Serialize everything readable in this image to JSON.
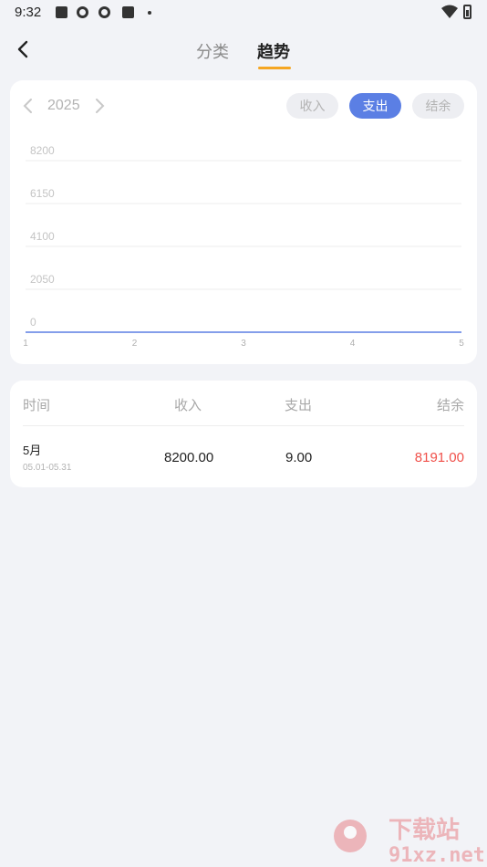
{
  "status_bar": {
    "time": "9:32"
  },
  "tabs": [
    {
      "label": "分类",
      "active": false
    },
    {
      "label": "趋势",
      "active": true
    }
  ],
  "year_selector": {
    "year": "2025"
  },
  "chart_filters": [
    {
      "label": "收入",
      "active": false
    },
    {
      "label": "支出",
      "active": true
    },
    {
      "label": "结余",
      "active": false
    }
  ],
  "colors": {
    "accent": "#5b7fe4",
    "tab_indicator": "#f5a623",
    "negative_text": "#f0504a"
  },
  "chart_data": {
    "type": "line",
    "title": "",
    "xlabel": "",
    "ylabel": "",
    "x": [
      1,
      2,
      3,
      4,
      5
    ],
    "series": [
      {
        "values": [
          0,
          0,
          0,
          0,
          0
        ]
      }
    ],
    "y_ticks": [
      "8200",
      "6150",
      "4100",
      "2050",
      "0"
    ],
    "x_ticks": [
      "1",
      "2",
      "3",
      "4",
      "5"
    ],
    "ylim": [
      0,
      8200
    ],
    "xlim": [
      1,
      5
    ],
    "grid": true
  },
  "table": {
    "headers": {
      "time": "时间",
      "income": "收入",
      "expense": "支出",
      "balance": "结余"
    },
    "rows": [
      {
        "month": "5月",
        "range": "05.01-05.31",
        "income": "8200.00",
        "expense": "9.00",
        "balance": "8191.00"
      }
    ]
  },
  "watermark": {
    "line1": "下载站",
    "line2": "91xz.net"
  }
}
